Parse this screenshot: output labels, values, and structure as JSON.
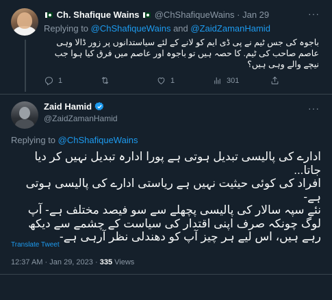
{
  "reply_tweet": {
    "author_name": "Ch. Shafique Wains",
    "author_handle": "@ChShafiqueWains",
    "separator": "·",
    "date": "Jan 29",
    "replying_prefix": "Replying to",
    "replying_user1": "@ChShafiqueWains",
    "replying_and": "and",
    "replying_user2": "@ZaidZamanHamid",
    "text": "باجوہ کی جس ٹیم نے پی ڈی ایم کو لانے کے لئے سیاستدانوں پر زور ڈالا وہی عاصم صاحب کی ٹیم. کا حصہ ہیں تو باجوہ اور عاصم میں فرق کیا ہوا جب نیچے والے وہی ہیں؟",
    "actions": {
      "replies": "1",
      "retweets": "",
      "likes": "1",
      "views": "301"
    }
  },
  "main_tweet": {
    "author_name": "Zaid Hamid",
    "author_handle": "@ZaidZamanHamid",
    "replying_prefix": "Replying to",
    "replying_user": "@ChShafiqueWains",
    "paragraphs": [
      "ادارے کی پالیسی تبدیل ہوتی ہے پورا ادارہ تبدیل نہیں کر دیا جاتا...",
      "افراد کی کوئی حیثیت نہیں ہے ریاستی ادارے کی پالیسی ہوتی ہے-",
      "نئے سپہ سالار کی پالیسی پچھلے سے سو فیصد مختلف ہے- آپ لوگ چونکہ صرف اپنی اقتدار کی سیاست کے چشمے سے دیکھ رہے ہیں، اس لیے ہر چیز آپ کو دھندلی نظر آرہی ہے-"
    ],
    "translate_label": "Translate Tweet",
    "time": "12:37 AM",
    "separator": "·",
    "date": "Jan 29, 2023",
    "views_count": "335",
    "views_label": "Views"
  },
  "colors": {
    "background": "#15202b",
    "text": "#f7f9f9",
    "muted": "#8b98a5",
    "accent": "#1d9bf0",
    "divider": "#38444d"
  },
  "icons": [
    "more-icon",
    "reply-icon",
    "retweet-icon",
    "like-icon",
    "views-icon",
    "share-icon",
    "verified-badge-icon",
    "pakistan-flag-icon"
  ]
}
